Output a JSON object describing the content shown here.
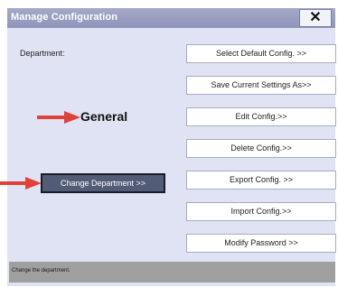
{
  "window": {
    "title": "Manage Configuration",
    "close_glyph": "✕"
  },
  "left_panel": {
    "department_label": "Department:",
    "department_value": "General",
    "change_department_button": "Change Department >>"
  },
  "buttons": [
    {
      "label": "Select Default Config. >>"
    },
    {
      "label": "Save Current Settings As>>"
    },
    {
      "label": "Edit Config.>>"
    },
    {
      "label": "Delete Config.>>"
    },
    {
      "label": "Export Config. >>"
    },
    {
      "label": "Import Config.>>"
    },
    {
      "label": "Modify Password >>"
    }
  ],
  "status": {
    "text": "Change the department."
  },
  "colors": {
    "arrow": "#e0423a",
    "titlebar": "#9aa0c2",
    "dialog_bg": "#dfe3f3",
    "selected_button": "#535c77",
    "statusbar": "#a09f9f"
  }
}
